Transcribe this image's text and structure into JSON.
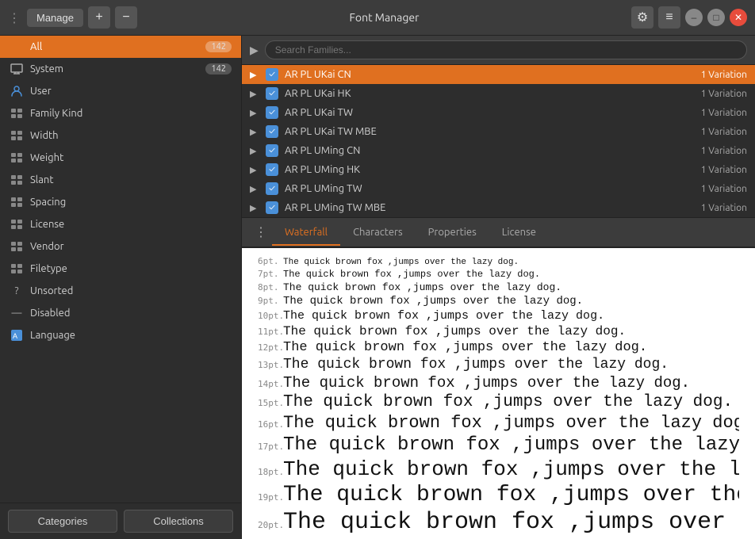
{
  "titlebar": {
    "manage_label": "Manage",
    "title": "Font Manager",
    "add_icon": "+",
    "remove_icon": "−",
    "gear_icon": "⚙",
    "menu_icon": "≡",
    "minimize_icon": "–",
    "maximize_icon": "□",
    "close_icon": "✕"
  },
  "sidebar": {
    "items": [
      {
        "id": "all",
        "icon": "B",
        "icon_type": "bold",
        "label": "All",
        "count": "142",
        "active": true
      },
      {
        "id": "system",
        "icon": "🖥",
        "icon_type": "emoji",
        "label": "System",
        "count": "142",
        "active": false
      },
      {
        "id": "user",
        "icon": "👤",
        "icon_type": "emoji",
        "label": "User",
        "count": "",
        "active": false
      },
      {
        "id": "family-kind",
        "icon": "🗂",
        "icon_type": "emoji",
        "label": "Family Kind",
        "count": "",
        "active": false
      },
      {
        "id": "width",
        "icon": "🗂",
        "icon_type": "emoji",
        "label": "Width",
        "count": "",
        "active": false
      },
      {
        "id": "weight",
        "icon": "🗂",
        "icon_type": "emoji",
        "label": "Weight",
        "count": "",
        "active": false
      },
      {
        "id": "slant",
        "icon": "🗂",
        "icon_type": "emoji",
        "label": "Slant",
        "count": "",
        "active": false
      },
      {
        "id": "spacing",
        "icon": "🗂",
        "icon_type": "emoji",
        "label": "Spacing",
        "count": "",
        "active": false
      },
      {
        "id": "license",
        "icon": "🗂",
        "icon_type": "emoji",
        "label": "License",
        "count": "",
        "active": false
      },
      {
        "id": "vendor",
        "icon": "🗂",
        "icon_type": "emoji",
        "label": "Vendor",
        "count": "",
        "active": false
      },
      {
        "id": "filetype",
        "icon": "🗂",
        "icon_type": "emoji",
        "label": "Filetype",
        "count": "",
        "active": false
      },
      {
        "id": "unsorted",
        "icon": "?",
        "icon_type": "text",
        "label": "Unsorted",
        "count": "",
        "active": false
      },
      {
        "id": "disabled",
        "icon": "—",
        "icon_type": "text",
        "label": "Disabled",
        "count": "",
        "active": false
      },
      {
        "id": "language",
        "icon": "A",
        "icon_type": "lang",
        "label": "Language",
        "count": "",
        "active": false
      }
    ],
    "footer": {
      "categories_label": "Categories",
      "collections_label": "Collections"
    }
  },
  "search": {
    "placeholder": "Search Families..."
  },
  "fonts": [
    {
      "name": "AR PL UKai CN",
      "variation": "1 Variation",
      "checked": true,
      "active": true,
      "expanded": true
    },
    {
      "name": "AR PL UKai HK",
      "variation": "1 Variation",
      "checked": true,
      "active": false,
      "expanded": false
    },
    {
      "name": "AR PL UKai TW",
      "variation": "1 Variation",
      "checked": true,
      "active": false,
      "expanded": false
    },
    {
      "name": "AR PL UKai TW MBE",
      "variation": "1 Variation",
      "checked": true,
      "active": false,
      "expanded": false
    },
    {
      "name": "AR PL UMing CN",
      "variation": "1 Variation",
      "checked": true,
      "active": false,
      "expanded": false
    },
    {
      "name": "AR PL UMing HK",
      "variation": "1 Variation",
      "checked": true,
      "active": false,
      "expanded": false
    },
    {
      "name": "AR PL UMing TW",
      "variation": "1 Variation",
      "checked": true,
      "active": false,
      "expanded": false
    },
    {
      "name": "AR PL UMing TW MBE",
      "variation": "1 Variation",
      "checked": true,
      "active": false,
      "expanded": false
    }
  ],
  "tabs": [
    {
      "id": "waterfall",
      "label": "Waterfall",
      "active": true
    },
    {
      "id": "characters",
      "label": "Characters",
      "active": false
    },
    {
      "id": "properties",
      "label": "Properties",
      "active": false
    },
    {
      "id": "license",
      "label": "License",
      "active": false
    }
  ],
  "preview": {
    "sample_text": "The quick brown fox ,jumps over the lazy dog.",
    "lines": [
      {
        "pt": "6pt.",
        "size": 11
      },
      {
        "pt": "7pt.",
        "size": 12
      },
      {
        "pt": "8pt.",
        "size": 13
      },
      {
        "pt": "9pt.",
        "size": 14
      },
      {
        "pt": "10pt.",
        "size": 15
      },
      {
        "pt": "11pt.",
        "size": 16
      },
      {
        "pt": "12pt.",
        "size": 17
      },
      {
        "pt": "13pt.",
        "size": 18
      },
      {
        "pt": "14pt.",
        "size": 19
      },
      {
        "pt": "15pt.",
        "size": 21
      },
      {
        "pt": "16pt.",
        "size": 22
      },
      {
        "pt": "17pt.",
        "size": 24
      },
      {
        "pt": "18pt.",
        "size": 26
      },
      {
        "pt": "19pt.",
        "size": 28
      },
      {
        "pt": "20pt.",
        "size": 30
      }
    ]
  },
  "colors": {
    "active_orange": "#e07020",
    "checked_blue": "#4a90d9"
  }
}
